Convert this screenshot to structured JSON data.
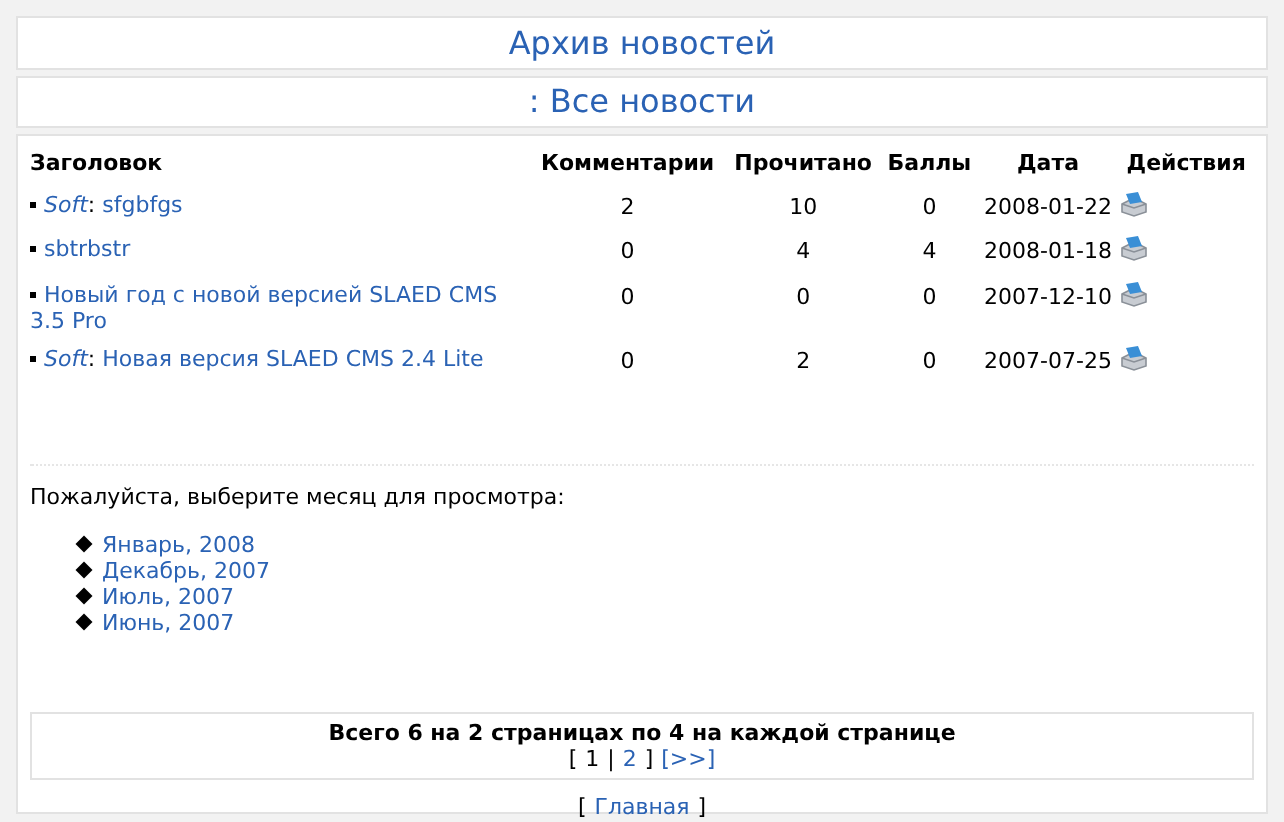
{
  "title": "Архив новостей",
  "subtitle": ": Все новости",
  "table": {
    "columns": [
      "Заголовок",
      "Комментарии",
      "Прочитано",
      "Баллы",
      "Дата",
      "Действия"
    ],
    "rows": [
      {
        "category": "Soft",
        "separator": ":",
        "title": "sfgbfgs",
        "comments": "2",
        "reads": "10",
        "score": "0",
        "date": "2008-01-22"
      },
      {
        "title": "sbtrbstr",
        "comments": "0",
        "reads": "4",
        "score": "4",
        "date": "2008-01-18"
      },
      {
        "title": "Новый год с новой версией SLAED CMS 3.5 Pro",
        "comments": "0",
        "reads": "0",
        "score": "0",
        "date": "2007-12-10"
      },
      {
        "category": "Soft",
        "separator": ":",
        "title": "Новая версия SLAED CMS 2.4 Lite",
        "comments": "0",
        "reads": "2",
        "score": "0",
        "date": "2007-07-25"
      }
    ]
  },
  "month_prompt": "Пожалуйста, выберите месяц для просмотра:",
  "months": [
    "Январь, 2008",
    "Декабрь, 2007",
    "Июль, 2007",
    "Июнь, 2007"
  ],
  "pager": {
    "summary": "Всего 6 на 2 страницах по 4 на каждой странице",
    "open": "[",
    "divider": "|",
    "close": "]",
    "pages": [
      {
        "label": "1",
        "selected": true
      },
      {
        "label": "2",
        "selected": false
      }
    ],
    "next": "[>>]"
  },
  "home": {
    "open": "[",
    "link": "Главная",
    "close": "]"
  }
}
